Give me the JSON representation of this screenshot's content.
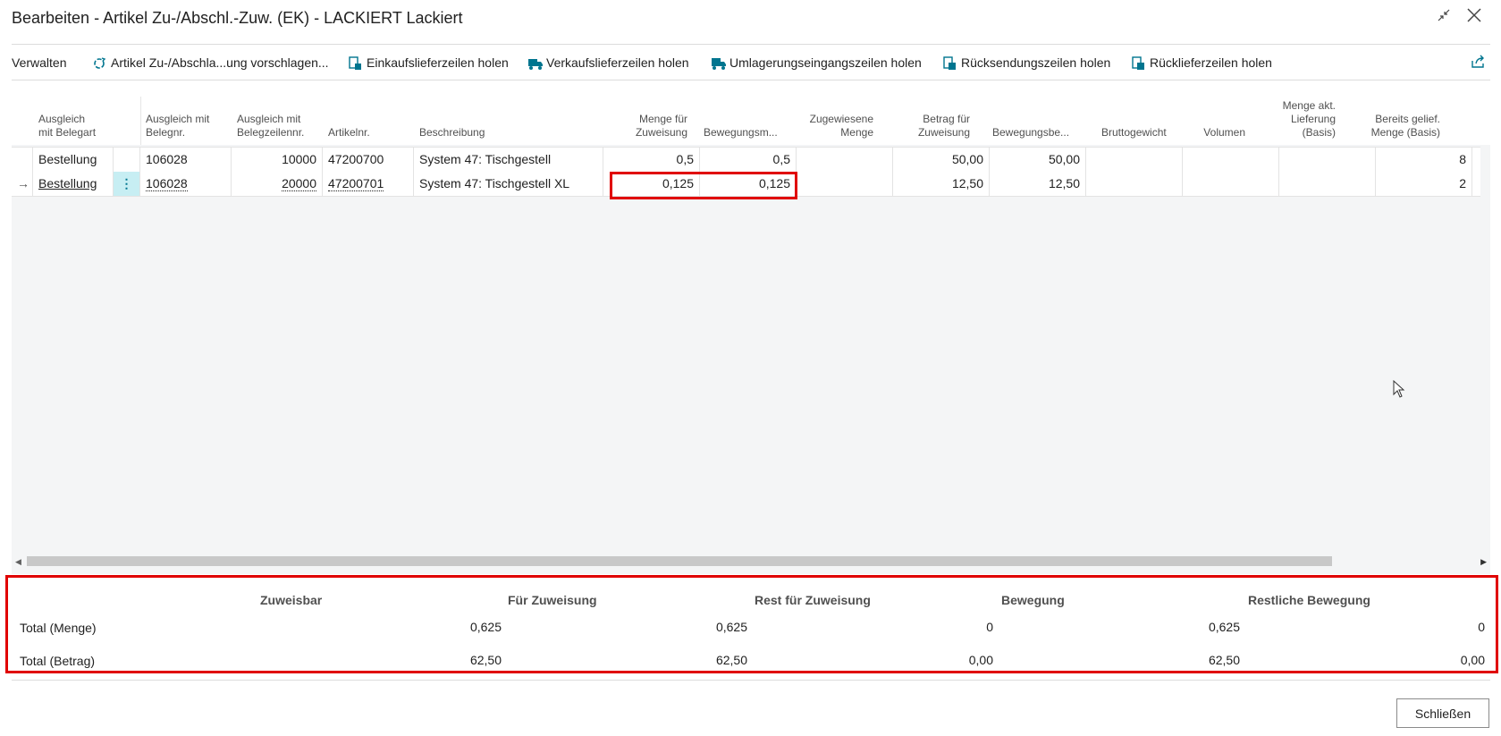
{
  "window": {
    "title": "Bearbeiten - Artikel Zu-/Abschl.-Zuw. (EK) - LACKIERT Lackiert"
  },
  "actions": {
    "verwalten": "Verwalten",
    "suggest": "Artikel Zu-/Abschla...ung vorschlagen...",
    "purchase_receipts": "Einkaufslieferzeilen holen",
    "sales_shipments": "Verkaufslieferzeilen holen",
    "transfer_receipts": "Umlagerungseingangszeilen holen",
    "return_shipments": "Rücksendungszeilen holen",
    "return_receipts": "Rücklieferzeilen holen"
  },
  "grid": {
    "columns": {
      "appl_doc_type": "Ausgleich\nmit Belegart",
      "appl_doc_no": "Ausgleich mit\nBelegnr.",
      "appl_line_no": "Ausgleich mit\nBelegzeilennr.",
      "item_no": "Artikelnr.",
      "description": "Beschreibung",
      "qty_to_assign": "Menge für\nZuweisung",
      "movement_qty": "Bewegungsm...",
      "assigned_qty": "Zugewiesene\nMenge",
      "amount_to_assign": "Betrag für\nZuweisung",
      "movement_amount": "Bewegungsbe...",
      "gross_weight": "Bruttogewicht",
      "volume": "Volumen",
      "qty_current_shipment": "Menge akt.\nLieferung\n(Basis)",
      "qty_already_shipped": "Bereits gelief.\nMenge (Basis)"
    },
    "rows": [
      {
        "doc_type": "Bestellung",
        "doc_no": "106028",
        "line_no": "10000",
        "item_no": "47200700",
        "description": "System 47: Tischgestell",
        "qty_to_assign": "0,5",
        "movement_qty": "0,5",
        "assigned_qty": "",
        "amount_to_assign": "50,00",
        "movement_amount": "50,00",
        "gross_weight": "",
        "volume": "",
        "qty_current_shipment": "",
        "qty_already_shipped": "8"
      },
      {
        "doc_type": "Bestellung",
        "doc_no": "106028",
        "line_no": "20000",
        "item_no": "47200701",
        "description": "System 47: Tischgestell XL",
        "qty_to_assign": "0,125",
        "movement_qty": "0,125",
        "assigned_qty": "",
        "amount_to_assign": "12,50",
        "movement_amount": "12,50",
        "gross_weight": "",
        "volume": "",
        "qty_current_shipment": "",
        "qty_already_shipped": "2"
      }
    ]
  },
  "summary": {
    "headers": {
      "assignable": "Zuweisbar",
      "to_assign": "Für Zuweisung",
      "rem_to_assign": "Rest für Zuweisung",
      "movement": "Bewegung",
      "rem_movement": "Restliche Bewegung"
    },
    "qty": {
      "label": "Total (Menge)",
      "assignable": "0,625",
      "to_assign": "0,625",
      "rem_to_assign": "0",
      "movement": "0,625",
      "rem_movement": "0"
    },
    "amount": {
      "label": "Total (Betrag)",
      "assignable": "62,50",
      "to_assign": "62,50",
      "rem_to_assign": "0,00",
      "movement": "62,50",
      "rem_movement": "0,00"
    }
  },
  "footer": {
    "close_label": "Schließen"
  },
  "colors": {
    "accent": "#00758f",
    "highlight": "#e00000",
    "selected_cell": "#c7eef3"
  },
  "icons": [
    "suggest-icon",
    "document-icon",
    "truck-icon",
    "transfer-truck-icon",
    "return-document-icon",
    "share-icon",
    "collapse-icon",
    "close-icon",
    "row-arrow-icon",
    "more-options-icon"
  ]
}
